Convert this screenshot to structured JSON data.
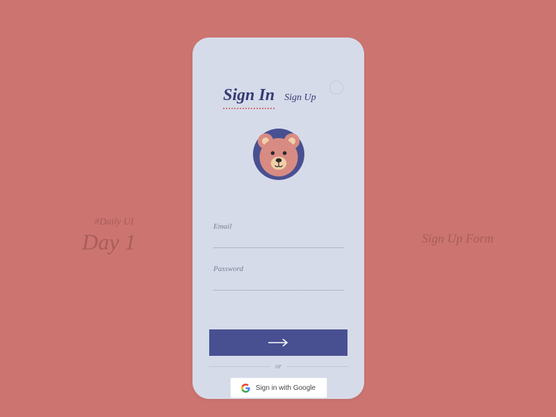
{
  "left_caption": {
    "hash": "#Daily UI",
    "day": "Day 1"
  },
  "right_caption": "Sign Up Form",
  "tabs": {
    "active": "Sign In",
    "inactive": "Sign Up"
  },
  "fields": {
    "email": {
      "label": "Email"
    },
    "password": {
      "label": "Password"
    }
  },
  "or_text": "or",
  "google_button": "Sign in with Google"
}
